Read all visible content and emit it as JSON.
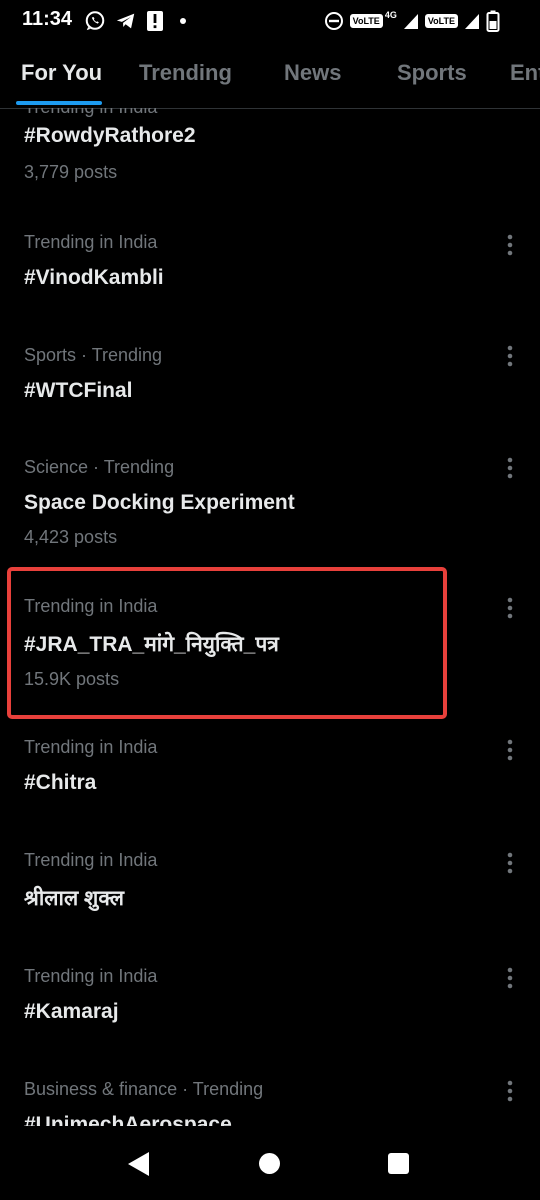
{
  "status_bar": {
    "time": "11:34",
    "network_label": "4G",
    "volte_label_1": "VoLTE",
    "volte_label_2": "VoLTE"
  },
  "tabs": [
    {
      "label": "For You",
      "active": true
    },
    {
      "label": "Trending",
      "active": false
    },
    {
      "label": "News",
      "active": false
    },
    {
      "label": "Sports",
      "active": false
    },
    {
      "label": "Ent",
      "active": false
    }
  ],
  "trends": [
    {
      "context": "Trending in India",
      "name": "#RowdyRathore2",
      "posts": "3,779 posts"
    },
    {
      "context": "Trending in India",
      "name": "#VinodKambli",
      "posts": ""
    },
    {
      "context": "Sports · Trending",
      "name": "#WTCFinal",
      "posts": ""
    },
    {
      "context": "Science · Trending",
      "name": "Space Docking Experiment",
      "posts": "4,423 posts"
    },
    {
      "context": "Trending in India",
      "name": "#JRA_TRA_मांगे_नियुक्ति_पत्र",
      "posts": "15.9K posts",
      "highlighted": true
    },
    {
      "context": "Trending in India",
      "name": "#Chitra",
      "posts": ""
    },
    {
      "context": "Trending in India",
      "name": "श्रीलाल शुक्ल",
      "posts": ""
    },
    {
      "context": "Trending in India",
      "name": "#Kamaraj",
      "posts": ""
    },
    {
      "context": "Business & finance · Trending",
      "name": "#UnimechAerospace",
      "posts": ""
    }
  ],
  "icons": {
    "more": "more-vertical-icon",
    "back": "back-triangle-icon",
    "home": "home-circle-icon",
    "recents": "recents-square-icon"
  },
  "colors": {
    "background": "#000000",
    "text_primary": "#e7e9ea",
    "text_secondary": "#71767b",
    "accent": "#1d9bf0",
    "highlight": "#e8403b"
  }
}
